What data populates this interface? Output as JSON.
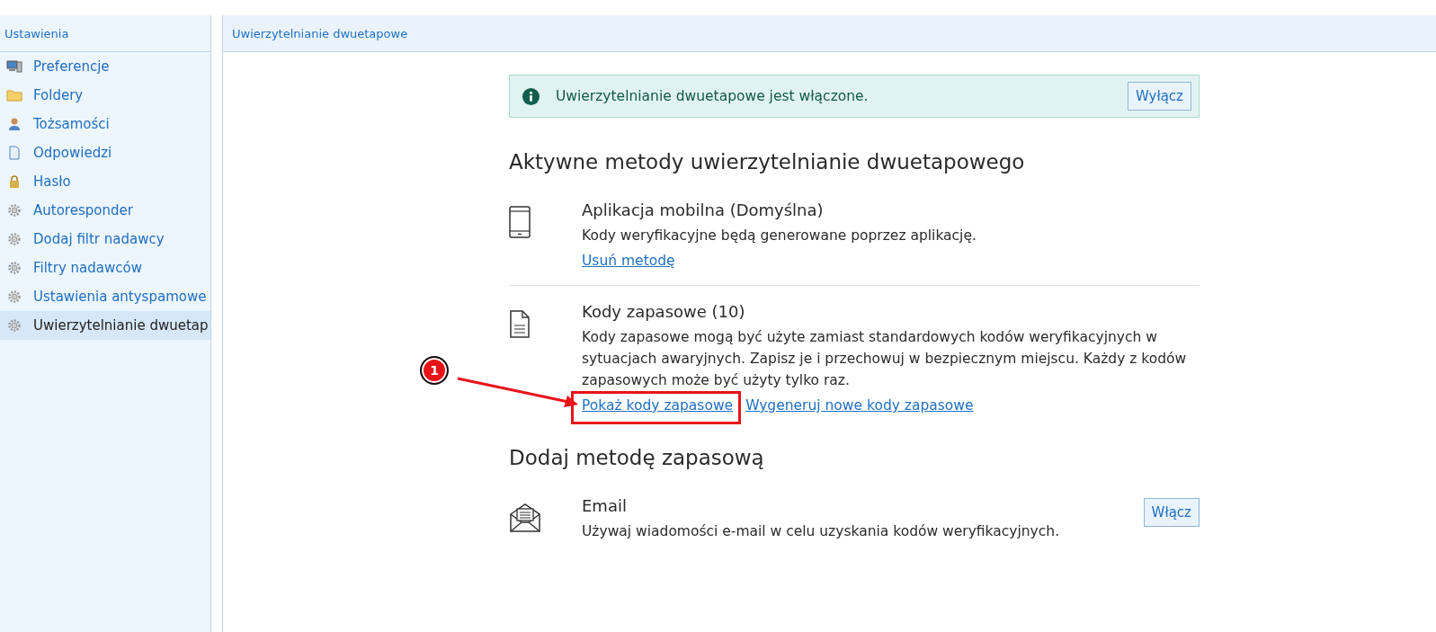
{
  "sidebar": {
    "title": "Ustawienia",
    "items": [
      {
        "label": "Preferencje",
        "kind": "monitor",
        "selected": false
      },
      {
        "label": "Foldery",
        "kind": "folder",
        "selected": false
      },
      {
        "label": "Tożsamości",
        "kind": "person",
        "selected": false
      },
      {
        "label": "Odpowiedzi",
        "kind": "document",
        "selected": false
      },
      {
        "label": "Hasło",
        "kind": "lock",
        "selected": false
      },
      {
        "label": "Autoresponder",
        "kind": "gear",
        "selected": false
      },
      {
        "label": "Dodaj filtr nadawcy",
        "kind": "gear",
        "selected": false
      },
      {
        "label": "Filtry nadawców",
        "kind": "gear",
        "selected": false
      },
      {
        "label": "Ustawienia antyspamowe",
        "kind": "gear",
        "selected": false
      },
      {
        "label": "Uwierzytelnianie dwuetap",
        "kind": "gear",
        "selected": true
      }
    ]
  },
  "panel": {
    "title": "Uwierzytelnianie dwuetapowe"
  },
  "notice": {
    "text": "Uwierzytelnianie dwuetapowe jest włączone.",
    "button": "Wyłącz"
  },
  "sections": [
    {
      "heading": "Aktywne metody uwierzytelnianie dwuetapowego",
      "methods": [
        {
          "kind": "phone",
          "title": "Aplikacja mobilna (Domyślna)",
          "description": "Kody weryfikacyjne będą generowane poprzez aplikację.",
          "links": [
            {
              "label": "Usuń metodę",
              "highlighted": false
            }
          ]
        },
        {
          "kind": "document",
          "title": "Kody zapasowe (10)",
          "description": "Kody zapasowe mogą być użyte zamiast standardowych kodów weryfikacyjnych w sytuacjach awaryjnych. Zapisz je i przechowuj w bezpiecznym miejscu. Każdy z kodów zapasowych może być użyty tylko raz.",
          "links": [
            {
              "label": "Pokaż kody zapasowe",
              "highlighted": true
            },
            {
              "label": "Wygeneruj nowe kody zapasowe",
              "highlighted": false
            }
          ]
        }
      ]
    },
    {
      "heading": "Dodaj metodę zapasową",
      "methods": [
        {
          "kind": "envelope",
          "title": "Email",
          "description": "Używaj wiadomości e-mail w celu uzyskania kodów weryfikacyjnych.",
          "button": "Włącz"
        }
      ]
    }
  ],
  "annotation": {
    "label": "1"
  }
}
